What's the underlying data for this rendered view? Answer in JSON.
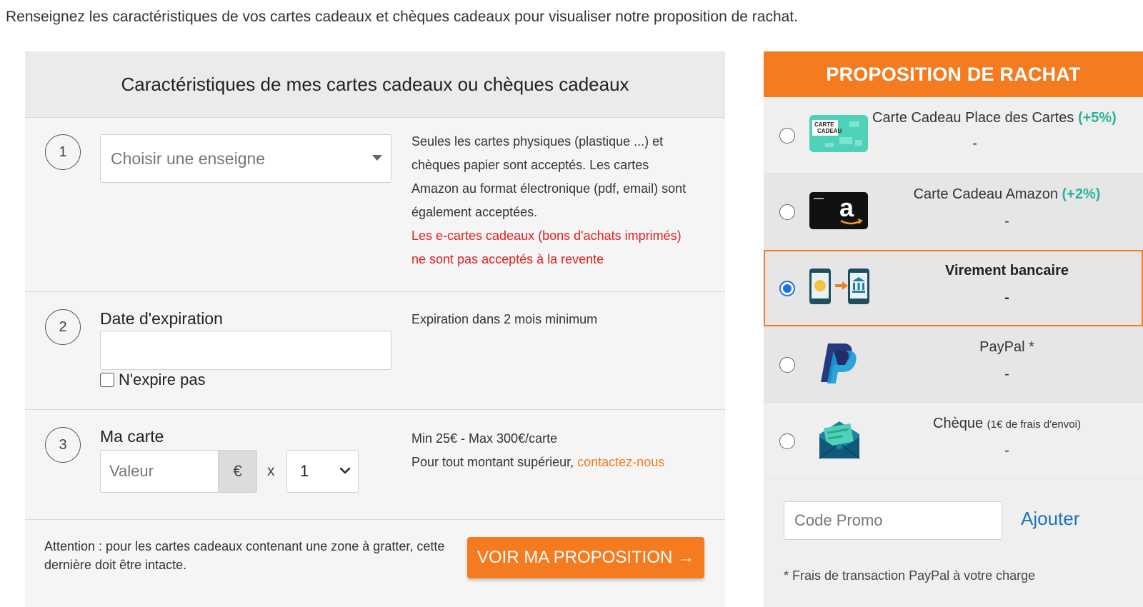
{
  "intro": "Renseignez les caractéristiques de vos cartes cadeaux et chèques cadeaux pour visualiser notre proposition de rachat.",
  "form": {
    "title": "Caractéristiques de mes cartes cadeaux ou chèques cadeaux",
    "step1": {
      "number": "1",
      "select_placeholder": "Choisir une enseigne",
      "info_line1": "Seules les cartes physiques (plastique ...) et",
      "info_line2": "chèques papier sont acceptés. Les cartes",
      "info_line3": "Amazon au format électronique (pdf, email) sont",
      "info_line4": "également acceptées.",
      "warning_line1": "Les e-cartes cadeaux (bons d'achats imprimés)",
      "warning_line2": "ne sont pas acceptés à la revente"
    },
    "step2": {
      "number": "2",
      "label": "Date d'expiration",
      "checkbox_label": "N'expire pas",
      "info": "Expiration dans 2 mois minimum"
    },
    "step3": {
      "number": "3",
      "label": "Ma carte",
      "value_placeholder": "Valeur",
      "currency": "€",
      "times": "x",
      "quantity": "1",
      "info_line1": "Min 25€ - Max 300€/carte",
      "info_line2": "Pour tout montant supérieur, ",
      "contact_link": "contactez-nous"
    },
    "footer_note": "Attention : pour les cartes cadeaux contenant une zone à gratter, cette dernière doit être intacte.",
    "cta": "VOIR MA PROPOSITION →"
  },
  "offer": {
    "title": "PROPOSITION DE RACHAT",
    "options": [
      {
        "title": "Carte Cadeau Place des Cartes ",
        "bonus": "(+5%)",
        "value": "-",
        "selected": false,
        "icon": "carte-cadeau-icon",
        "icon_text_1": "CARTE",
        "icon_text_2": "CADEAU"
      },
      {
        "title": "Carte Cadeau Amazon ",
        "bonus": "(+2%)",
        "value": "-",
        "selected": false,
        "icon": "amazon-card-icon",
        "icon_text": "a"
      },
      {
        "title": "Virement bancaire",
        "value": "-",
        "selected": true,
        "icon": "bank-transfer-icon"
      },
      {
        "title": "PayPal *",
        "value": "-",
        "selected": false,
        "icon": "paypal-icon"
      },
      {
        "title": "Chèque ",
        "small": "(1€ de frais d'envoi)",
        "value": "-",
        "selected": false,
        "icon": "cheque-envelope-icon"
      }
    ],
    "promo_placeholder": "Code Promo",
    "promo_button": "Ajouter",
    "paypal_note": "* Frais de transaction PayPal à votre charge"
  },
  "colors": {
    "accent": "#f47b20",
    "bonus": "#2bb39a",
    "warning": "#e02020",
    "link": "#1e73be",
    "radio": "#1a73e8"
  }
}
